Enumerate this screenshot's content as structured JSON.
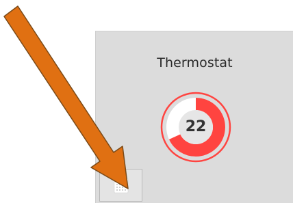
{
  "tile": {
    "title": "Thermostat",
    "gauge": {
      "value": "22",
      "fill_fraction": 0.68,
      "color": "#ff4440",
      "track_color": "#e6e6e6"
    }
  },
  "icons": {
    "action_button": "grid-icon",
    "pointer": "arrow-pointer-icon"
  },
  "colors": {
    "tile_background": "#dcdcdc",
    "arrow": "#e07012"
  }
}
